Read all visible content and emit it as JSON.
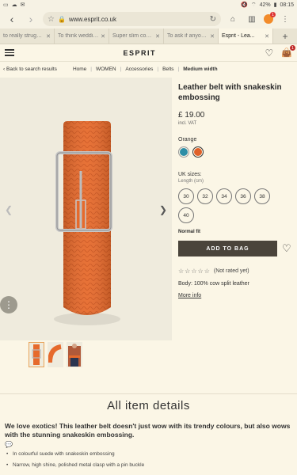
{
  "status": {
    "left_icons": [
      "tablet-icon",
      "cloud-icon",
      "message-icon"
    ],
    "battery": "42%",
    "time": "08:15"
  },
  "browser": {
    "url": "www.esprit.co.uk",
    "tabs": [
      {
        "label": "to really struggle..."
      },
      {
        "label": "To think wedding..."
      },
      {
        "label": "Super slim cons..."
      },
      {
        "label": "To ask if anyone'..."
      },
      {
        "label": "Esprit - Lea..."
      }
    ],
    "extension_badge": "1"
  },
  "site": {
    "logo": "ESPRIT",
    "bag_count": "1"
  },
  "breadcrumb": {
    "back": "Back to search results",
    "items": [
      "Home",
      "WOMEN",
      "Accessories",
      "Belts"
    ],
    "current": "Medium width"
  },
  "product": {
    "title": "Leather belt with snakeskin embossing",
    "price": "£ 19.00",
    "vat": "incl. VAT",
    "color_label": "Orange",
    "colors": [
      {
        "name": "teal",
        "hex": "#2d8ea6"
      },
      {
        "name": "orange",
        "hex": "#e0612a"
      }
    ],
    "sizes_label": "UK sizes:",
    "length_label": "Length (cm)",
    "sizes": [
      "30",
      "32",
      "34",
      "36",
      "38",
      "40"
    ],
    "fit": "Normal fit",
    "add_to_bag": "ADD TO BAG",
    "rating_text": "(Not rated yet)",
    "material": "Body: 100% cow split leather",
    "more_info": "More info"
  },
  "details": {
    "title": "All item details",
    "intro": "We love exotics! This leather belt doesn't just wow with its trendy colours, but also wows with the stunning snakeskin embossing.",
    "bullets": [
      "In colourful suede with snakeskin embossing",
      "Narrow, high shine, polished metal clasp with a pin buckle"
    ]
  }
}
